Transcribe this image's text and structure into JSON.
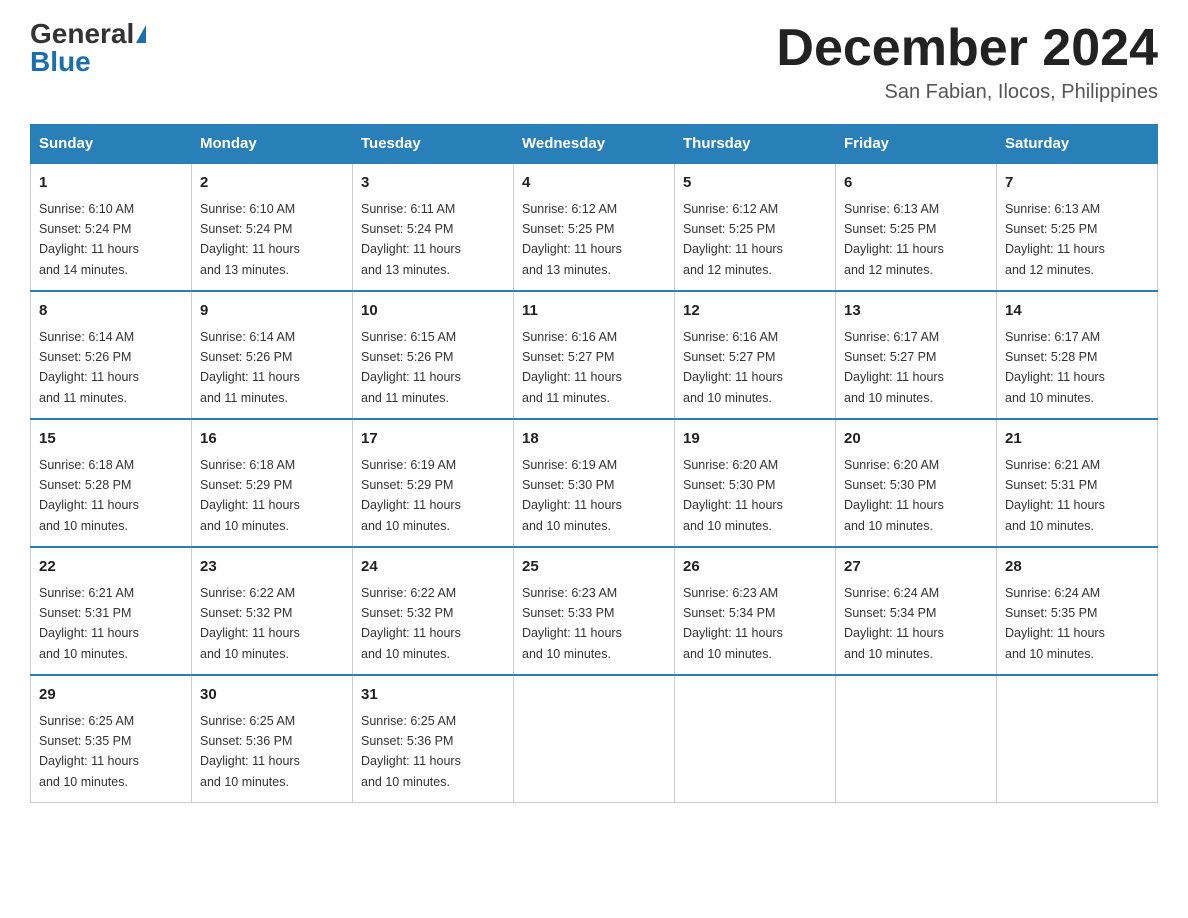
{
  "logo": {
    "general": "General",
    "blue": "Blue"
  },
  "title": "December 2024",
  "location": "San Fabian, Ilocos, Philippines",
  "days_of_week": [
    "Sunday",
    "Monday",
    "Tuesday",
    "Wednesday",
    "Thursday",
    "Friday",
    "Saturday"
  ],
  "weeks": [
    [
      {
        "day": "1",
        "sunrise": "6:10 AM",
        "sunset": "5:24 PM",
        "daylight": "11 hours and 14 minutes."
      },
      {
        "day": "2",
        "sunrise": "6:10 AM",
        "sunset": "5:24 PM",
        "daylight": "11 hours and 13 minutes."
      },
      {
        "day": "3",
        "sunrise": "6:11 AM",
        "sunset": "5:24 PM",
        "daylight": "11 hours and 13 minutes."
      },
      {
        "day": "4",
        "sunrise": "6:12 AM",
        "sunset": "5:25 PM",
        "daylight": "11 hours and 13 minutes."
      },
      {
        "day": "5",
        "sunrise": "6:12 AM",
        "sunset": "5:25 PM",
        "daylight": "11 hours and 12 minutes."
      },
      {
        "day": "6",
        "sunrise": "6:13 AM",
        "sunset": "5:25 PM",
        "daylight": "11 hours and 12 minutes."
      },
      {
        "day": "7",
        "sunrise": "6:13 AM",
        "sunset": "5:25 PM",
        "daylight": "11 hours and 12 minutes."
      }
    ],
    [
      {
        "day": "8",
        "sunrise": "6:14 AM",
        "sunset": "5:26 PM",
        "daylight": "11 hours and 11 minutes."
      },
      {
        "day": "9",
        "sunrise": "6:14 AM",
        "sunset": "5:26 PM",
        "daylight": "11 hours and 11 minutes."
      },
      {
        "day": "10",
        "sunrise": "6:15 AM",
        "sunset": "5:26 PM",
        "daylight": "11 hours and 11 minutes."
      },
      {
        "day": "11",
        "sunrise": "6:16 AM",
        "sunset": "5:27 PM",
        "daylight": "11 hours and 11 minutes."
      },
      {
        "day": "12",
        "sunrise": "6:16 AM",
        "sunset": "5:27 PM",
        "daylight": "11 hours and 10 minutes."
      },
      {
        "day": "13",
        "sunrise": "6:17 AM",
        "sunset": "5:27 PM",
        "daylight": "11 hours and 10 minutes."
      },
      {
        "day": "14",
        "sunrise": "6:17 AM",
        "sunset": "5:28 PM",
        "daylight": "11 hours and 10 minutes."
      }
    ],
    [
      {
        "day": "15",
        "sunrise": "6:18 AM",
        "sunset": "5:28 PM",
        "daylight": "11 hours and 10 minutes."
      },
      {
        "day": "16",
        "sunrise": "6:18 AM",
        "sunset": "5:29 PM",
        "daylight": "11 hours and 10 minutes."
      },
      {
        "day": "17",
        "sunrise": "6:19 AM",
        "sunset": "5:29 PM",
        "daylight": "11 hours and 10 minutes."
      },
      {
        "day": "18",
        "sunrise": "6:19 AM",
        "sunset": "5:30 PM",
        "daylight": "11 hours and 10 minutes."
      },
      {
        "day": "19",
        "sunrise": "6:20 AM",
        "sunset": "5:30 PM",
        "daylight": "11 hours and 10 minutes."
      },
      {
        "day": "20",
        "sunrise": "6:20 AM",
        "sunset": "5:30 PM",
        "daylight": "11 hours and 10 minutes."
      },
      {
        "day": "21",
        "sunrise": "6:21 AM",
        "sunset": "5:31 PM",
        "daylight": "11 hours and 10 minutes."
      }
    ],
    [
      {
        "day": "22",
        "sunrise": "6:21 AM",
        "sunset": "5:31 PM",
        "daylight": "11 hours and 10 minutes."
      },
      {
        "day": "23",
        "sunrise": "6:22 AM",
        "sunset": "5:32 PM",
        "daylight": "11 hours and 10 minutes."
      },
      {
        "day": "24",
        "sunrise": "6:22 AM",
        "sunset": "5:32 PM",
        "daylight": "11 hours and 10 minutes."
      },
      {
        "day": "25",
        "sunrise": "6:23 AM",
        "sunset": "5:33 PM",
        "daylight": "11 hours and 10 minutes."
      },
      {
        "day": "26",
        "sunrise": "6:23 AM",
        "sunset": "5:34 PM",
        "daylight": "11 hours and 10 minutes."
      },
      {
        "day": "27",
        "sunrise": "6:24 AM",
        "sunset": "5:34 PM",
        "daylight": "11 hours and 10 minutes."
      },
      {
        "day": "28",
        "sunrise": "6:24 AM",
        "sunset": "5:35 PM",
        "daylight": "11 hours and 10 minutes."
      }
    ],
    [
      {
        "day": "29",
        "sunrise": "6:25 AM",
        "sunset": "5:35 PM",
        "daylight": "11 hours and 10 minutes."
      },
      {
        "day": "30",
        "sunrise": "6:25 AM",
        "sunset": "5:36 PM",
        "daylight": "11 hours and 10 minutes."
      },
      {
        "day": "31",
        "sunrise": "6:25 AM",
        "sunset": "5:36 PM",
        "daylight": "11 hours and 10 minutes."
      },
      null,
      null,
      null,
      null
    ]
  ],
  "labels": {
    "sunrise": "Sunrise:",
    "sunset": "Sunset:",
    "daylight": "Daylight:"
  }
}
